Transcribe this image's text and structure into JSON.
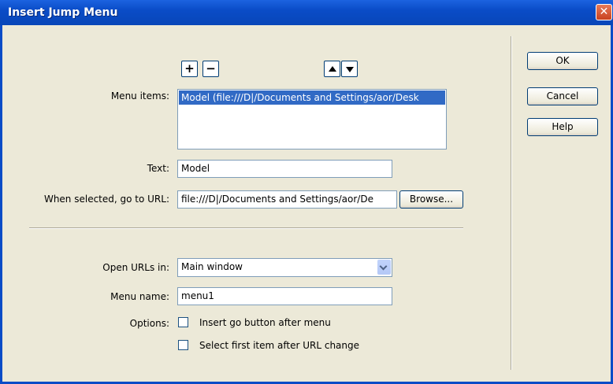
{
  "window": {
    "title": "Insert Jump Menu",
    "close_label": "✕"
  },
  "list_buttons": {
    "add": "+",
    "remove": "−"
  },
  "menu_items": {
    "label": "Menu items:",
    "items": [
      "Model (file:///D|/Documents and Settings/aor/Desk"
    ]
  },
  "text": {
    "label": "Text:",
    "value": "Model"
  },
  "url": {
    "label": "When selected, go to URL:",
    "value": "file:///D|/Documents and Settings/aor/De",
    "browse_label": "Browse..."
  },
  "open_in": {
    "label": "Open URLs in:",
    "value": "Main window"
  },
  "menu_name": {
    "label": "Menu name:",
    "value": "menu1"
  },
  "options": {
    "label": "Options:",
    "go_button": "Insert go button after menu",
    "select_first": "Select first item after URL change"
  },
  "buttons": {
    "ok": "OK",
    "cancel": "Cancel",
    "help": "Help"
  }
}
